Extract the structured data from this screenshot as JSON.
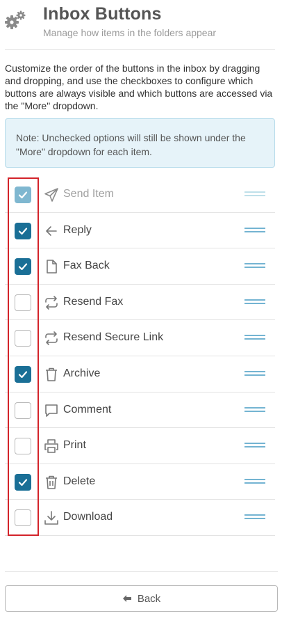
{
  "header": {
    "title": "Inbox Buttons",
    "subtitle": "Manage how items in the folders appear",
    "icon": "gears-icon"
  },
  "description": "Customize the order of the buttons in the inbox by dragging and dropping, and use the checkboxes to configure which buttons are always visible and which buttons are accessed via the \"More\" dropdown.",
  "note": "Note: Unchecked options will still be shown under the \"More\" dropdown for each item.",
  "colors": {
    "accent": "#1a6f96",
    "note_background": "#e6f3f9",
    "highlight_box": "#d3232a",
    "drag_handle": "#74b4d2"
  },
  "buttons": [
    {
      "label": "Send Item",
      "icon": "send-icon",
      "checked": true,
      "disabled": true
    },
    {
      "label": "Reply",
      "icon": "reply-arrow-icon",
      "checked": true,
      "disabled": false
    },
    {
      "label": "Fax Back",
      "icon": "document-icon",
      "checked": true,
      "disabled": false
    },
    {
      "label": "Resend Fax",
      "icon": "repeat-icon",
      "checked": false,
      "disabled": false
    },
    {
      "label": "Resend Secure Link",
      "icon": "repeat-icon",
      "checked": false,
      "disabled": false
    },
    {
      "label": "Archive",
      "icon": "trash-icon",
      "checked": true,
      "disabled": false
    },
    {
      "label": "Comment",
      "icon": "comment-icon",
      "checked": false,
      "disabled": false
    },
    {
      "label": "Print",
      "icon": "printer-icon",
      "checked": false,
      "disabled": false
    },
    {
      "label": "Delete",
      "icon": "trash-can-icon",
      "checked": true,
      "disabled": false
    },
    {
      "label": "Download",
      "icon": "download-icon",
      "checked": false,
      "disabled": false
    }
  ],
  "footer": {
    "back_label": "Back",
    "back_icon": "arrow-left-icon"
  }
}
